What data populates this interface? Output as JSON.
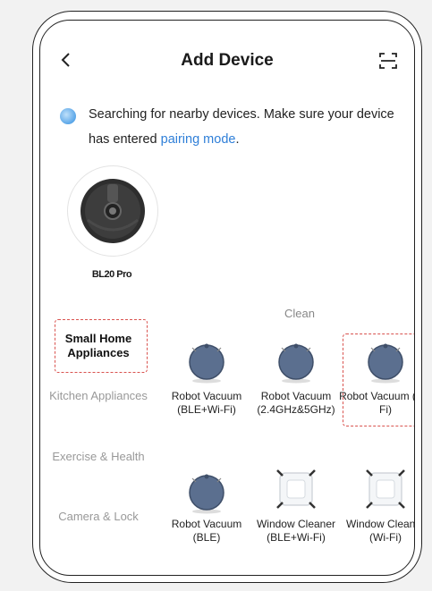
{
  "header": {
    "title": "Add Device"
  },
  "search": {
    "text": "Searching for nearby devices. Make sure your device has entered ",
    "link": "pairing mode",
    "suffix": "."
  },
  "found_device": {
    "name": "BL20 Pro"
  },
  "section_title": "Clean",
  "categories": [
    {
      "label": "Small Home Appliances",
      "active": true
    },
    {
      "label": "Kitchen Appliances"
    },
    {
      "label": "Exercise & Health"
    },
    {
      "label": "Camera & Lock"
    }
  ],
  "products": [
    {
      "label": "Robot Vacuum (BLE+Wi-Fi)",
      "icon": "robot-vacuum-icon"
    },
    {
      "label": "Robot Vacuum (2.4GHz&5GHz)",
      "icon": "robot-vacuum-icon"
    },
    {
      "label": "Robot Vacuum (Wi-Fi)",
      "icon": "robot-vacuum-icon",
      "highlighted": true
    },
    {
      "label": "Robot Vacuum (BLE)",
      "icon": "robot-vacuum-icon"
    },
    {
      "label": "Window Cleaner (BLE+Wi-Fi)",
      "icon": "window-cleaner-icon"
    },
    {
      "label": "Window Cleaner (Wi-Fi)",
      "icon": "window-cleaner-icon"
    }
  ],
  "colors": {
    "accent": "#2f7fd8",
    "highlight": "#d9534f",
    "vacuum": "#5b6f8f"
  }
}
